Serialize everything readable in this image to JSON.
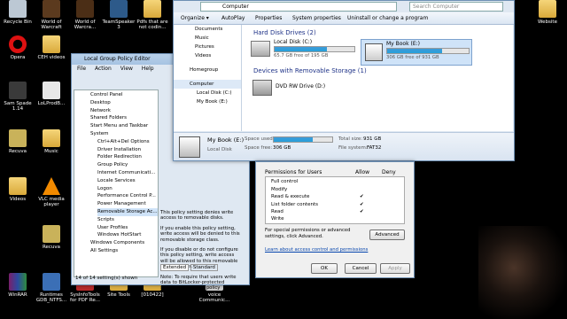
{
  "desktop": {
    "icons": [
      {
        "label": "Recycle Bin"
      },
      {
        "label": "World of Warcraft"
      },
      {
        "label": "World of Warcra..."
      },
      {
        "label": "TeamSpeaker 3"
      },
      {
        "label": "Pdfs that are not codin..."
      },
      {
        "label": "Website"
      },
      {
        "label": "Opera"
      },
      {
        "label": "CEH videos"
      },
      {
        "label": "Sam Spade 1.14"
      },
      {
        "label": "LoLProdB..."
      },
      {
        "label": "Recuva"
      },
      {
        "label": "Music"
      },
      {
        "label": "VLC media player"
      },
      {
        "label": "Videos"
      },
      {
        "label": "Recuva"
      },
      {
        "label": "WinRAR"
      },
      {
        "label": "Runtimes GDB_NTFS..."
      },
      {
        "label": "SysInfoTools for PDF Re..."
      },
      {
        "label": "Site Tools"
      },
      {
        "label": "[010422]"
      },
      {
        "label": "voice Communic..."
      }
    ]
  },
  "explorer": {
    "address": "Computer",
    "search_placeholder": "Search Computer",
    "toolbar": [
      "Organize ▾",
      "AutoPlay",
      "Properties",
      "System properties",
      "Uninstall or change a program"
    ],
    "nav": [
      "Documents",
      "Music",
      "Pictures",
      "Videos",
      "Homegroup",
      "Computer",
      "Local Disk (C:)",
      "My Book (E:)"
    ],
    "hdd_header": "Hard Disk Drives (2)",
    "drives": [
      {
        "name": "Local Disk (C:)",
        "free": "65.7 GB free of 195 GB",
        "used_fraction": 0.66
      },
      {
        "name": "My Book (E:)",
        "free": "306 GB free of 931 GB",
        "used_fraction": 0.67
      }
    ],
    "removable_header": "Devices with Removable Storage (1)",
    "dvd": "DVD RW Drive (D:)",
    "details": {
      "name": "My Book (E:)",
      "type": "Local Disk",
      "space_used_label": "Space used:",
      "space_free_label": "Space free:",
      "space_free": "306 GB",
      "total_label": "Total size:",
      "total": "931 GB",
      "fs_label": "File system:",
      "fs": "FAT32",
      "used_fraction": 0.67
    }
  },
  "gpedit": {
    "title": "Local Group Policy Editor",
    "menu": [
      "File",
      "Action",
      "View",
      "Help"
    ],
    "tree": [
      "Control Panel",
      "Desktop",
      "Network",
      "Shared Folders",
      "Start Menu and Taskbar",
      "System",
      "Ctrl+Alt+Del Options",
      "Driver Installation",
      "Folder Redirection",
      "Group Policy",
      "Internet Communicati...",
      "Locale Services",
      "Logon",
      "Performance Control P...",
      "Power Management",
      "Removable Storage Ac...",
      "Scripts",
      "User Profiles",
      "Windows HotStart",
      "Windows Components",
      "All Settings"
    ],
    "description": [
      "This policy setting denies write access to removable disks.",
      "If you enable this policy setting, write access will be denied to this removable storage class.",
      "If you disable or do not configure this policy setting, write access will be allowed to this removable storage class.",
      "Note: To require that users write data to BitLocker-protected storage enable the policy"
    ],
    "tabs": [
      "Extended",
      "Standard"
    ],
    "status": "14 of 14 setting(s) shown"
  },
  "permissions": {
    "header_label": "Permissions for Users",
    "col_allow": "Allow",
    "col_deny": "Deny",
    "rows": [
      {
        "name": "Full control",
        "allow": ""
      },
      {
        "name": "Modify",
        "allow": ""
      },
      {
        "name": "Read & execute",
        "allow": "✔"
      },
      {
        "name": "List folder contents",
        "allow": "✔"
      },
      {
        "name": "Read",
        "allow": "✔"
      },
      {
        "name": "Write",
        "allow": ""
      }
    ],
    "special_text": "For special permissions or advanced settings, click Advanced.",
    "advanced": "Advanced",
    "learn_link": "Learn about access control and permissions",
    "ok": "OK",
    "cancel": "Cancel",
    "apply": "Apply"
  }
}
